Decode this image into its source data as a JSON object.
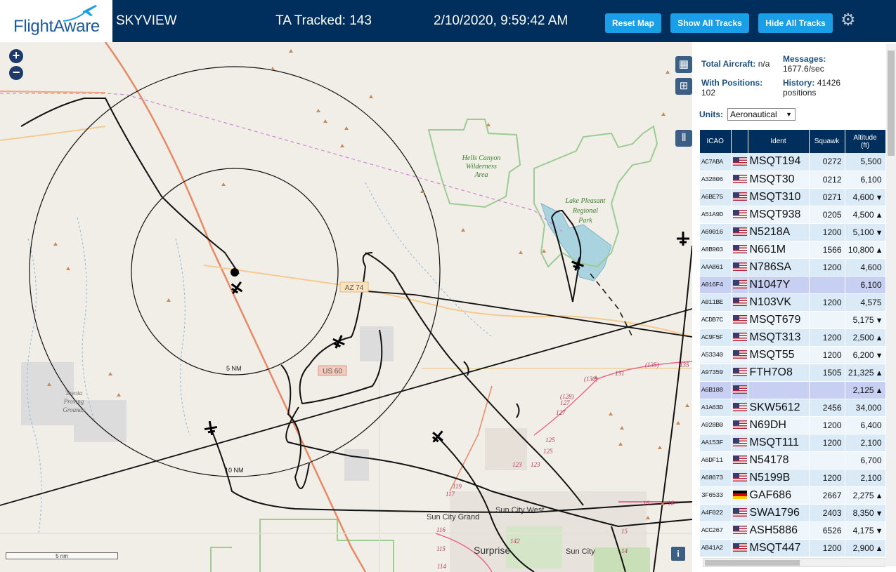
{
  "header": {
    "logo_text": "FlightAware",
    "title": "SKYVIEW",
    "tracked": "TA Tracked: 143",
    "clock": "2/10/2020, 9:59:42 AM",
    "buttons": {
      "reset": "Reset Map",
      "show": "Show All Tracks",
      "hide": "Hide All Tracks"
    },
    "gear_icon": "gear-icon"
  },
  "map": {
    "labels": {
      "hells_canyon": [
        "Hells Canyon",
        "Wilderness",
        "Area"
      ],
      "lake_pleasant": [
        "Lake Pleasant",
        "Regional",
        "Park"
      ],
      "proving_grounds": [
        "Toyota",
        "Proving",
        "Grounds"
      ],
      "ring_5nm": "5 NM",
      "ring_10nm": "10 NM",
      "az74": "AZ 74",
      "us60": "US 60",
      "sun_city_grand": "Sun City Grand",
      "sun_city_west": "Sun City West",
      "surprise": "Surprise",
      "sun_city": "Sun City",
      "r135a": "(135)",
      "r135b": "135",
      "r130": "(130)",
      "r131": "131",
      "r128": "(128)",
      "r127a": "127",
      "r127b": "127",
      "r125a": "125",
      "r125b": "125",
      "r123a": "123",
      "r123b": "123",
      "r119": "119",
      "r117": "117",
      "r116": "116",
      "r115": "115",
      "r114": "114",
      "r142": "142",
      "r18": "18",
      "r16": "16",
      "r15": "15",
      "r14": "14"
    },
    "scale_label": "5 nm",
    "info_label": "i"
  },
  "panel": {
    "total_aircraft_label": "Total Aircraft:",
    "total_aircraft_value": "n/a",
    "with_positions_label": "With Positions:",
    "with_positions_value": "102",
    "messages_label": "Messages:",
    "messages_value": "1677.6/sec",
    "history_label": "History:",
    "history_value": "41426",
    "history_unit": "positions",
    "units_label": "Units:",
    "units_value": "Aeronautical",
    "columns": {
      "icao": "ICAO",
      "ident": "Ident",
      "squawk": "Squawk",
      "altitude": "Altitude",
      "altitude_unit": "(ft)"
    },
    "rows": [
      {
        "icao": "AC7ABA",
        "flag": "us",
        "ident": "MSQT194",
        "squawk": "0272",
        "alt": "5,500",
        "trend": ""
      },
      {
        "icao": "A32806",
        "flag": "us",
        "ident": "MSQT30",
        "squawk": "0212",
        "alt": "6,100",
        "trend": ""
      },
      {
        "icao": "A6BE75",
        "flag": "us",
        "ident": "MSQT310",
        "squawk": "0271",
        "alt": "4,600",
        "trend": "▼"
      },
      {
        "icao": "A51A9D",
        "flag": "us",
        "ident": "MSQT938",
        "squawk": "0205",
        "alt": "4,500",
        "trend": "▲"
      },
      {
        "icao": "A69016",
        "flag": "us",
        "ident": "N5218A",
        "squawk": "1200",
        "alt": "5,100",
        "trend": "▼"
      },
      {
        "icao": "A8B903",
        "flag": "us",
        "ident": "N661M",
        "squawk": "1566",
        "alt": "10,800",
        "trend": "▲"
      },
      {
        "icao": "AAA861",
        "flag": "us",
        "ident": "N786SA",
        "squawk": "1200",
        "alt": "4,600",
        "trend": ""
      },
      {
        "icao": "A016F4",
        "flag": "us",
        "ident": "N1047Y",
        "squawk": "",
        "alt": "6,100",
        "trend": ""
      },
      {
        "icao": "A011BE",
        "flag": "us",
        "ident": "N103VK",
        "squawk": "1200",
        "alt": "4,575",
        "trend": ""
      },
      {
        "icao": "ACDB7C",
        "flag": "us",
        "ident": "MSQT679",
        "squawk": "",
        "alt": "5,175",
        "trend": "▼"
      },
      {
        "icao": "AC9F5F",
        "flag": "us",
        "ident": "MSQT313",
        "squawk": "1200",
        "alt": "2,500",
        "trend": "▲"
      },
      {
        "icao": "A53340",
        "flag": "us",
        "ident": "MSQT55",
        "squawk": "1200",
        "alt": "6,200",
        "trend": "▼"
      },
      {
        "icao": "A97359",
        "flag": "us",
        "ident": "FTH7O8",
        "squawk": "1505",
        "alt": "21,325",
        "trend": "▲"
      },
      {
        "icao": "A6B188",
        "flag": "us",
        "ident": "",
        "squawk": "",
        "alt": "2,125",
        "trend": "▲"
      },
      {
        "icao": "A1A63D",
        "flag": "us",
        "ident": "SKW5612",
        "squawk": "2456",
        "alt": "34,000",
        "trend": ""
      },
      {
        "icao": "A928B0",
        "flag": "us",
        "ident": "N69DH",
        "squawk": "1200",
        "alt": "6,400",
        "trend": ""
      },
      {
        "icao": "AA153F",
        "flag": "us",
        "ident": "MSQT111",
        "squawk": "1200",
        "alt": "2,100",
        "trend": ""
      },
      {
        "icao": "A6DF11",
        "flag": "us",
        "ident": "N54178",
        "squawk": "",
        "alt": "6,700",
        "trend": ""
      },
      {
        "icao": "A68673",
        "flag": "us",
        "ident": "N5199B",
        "squawk": "1200",
        "alt": "2,100",
        "trend": ""
      },
      {
        "icao": "3F6533",
        "flag": "de",
        "ident": "GAF686",
        "squawk": "2667",
        "alt": "2,275",
        "trend": "▲"
      },
      {
        "icao": "A4F022",
        "flag": "us",
        "ident": "SWA1796",
        "squawk": "2403",
        "alt": "8,350",
        "trend": "▼"
      },
      {
        "icao": "ACC267",
        "flag": "us",
        "ident": "ASH5886",
        "squawk": "6526",
        "alt": "4,175",
        "trend": "▼"
      },
      {
        "icao": "AB41A2",
        "flag": "us",
        "ident": "MSQT447",
        "squawk": "1200",
        "alt": "2,900",
        "trend": "▲"
      }
    ]
  }
}
